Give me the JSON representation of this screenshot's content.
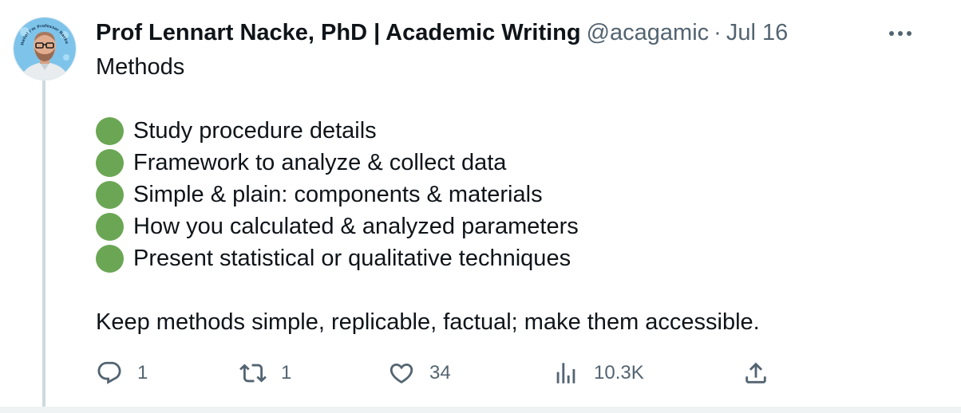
{
  "tweet": {
    "author_name": "Prof Lennart Nacke, PhD | Academic Writing",
    "handle": "@acagamic",
    "separator": "·",
    "date": "Jul 16",
    "intro": "Methods",
    "bullets": [
      "Study procedure details",
      "Framework to analyze & collect data",
      "Simple & plain: components & materials",
      "How you calculated & analyzed parameters",
      "Present statistical or qualitative techniques"
    ],
    "closing": "Keep methods simple, replicable, factual; make them accessible.",
    "bullet_color": "#6ba654"
  },
  "avatar": {
    "badge_text": "Hello! I'm Professor Nacke"
  },
  "actions": {
    "replies": "1",
    "retweets": "1",
    "likes": "34",
    "views": "10.3K"
  },
  "icons": {
    "more": "more-horizontal-icon",
    "reply": "reply-icon",
    "retweet": "retweet-icon",
    "like": "heart-icon",
    "views": "analytics-icon",
    "share": "share-icon"
  },
  "colors": {
    "text": "#0f1419",
    "secondary": "#536471",
    "thread_line": "#cfd9de"
  }
}
